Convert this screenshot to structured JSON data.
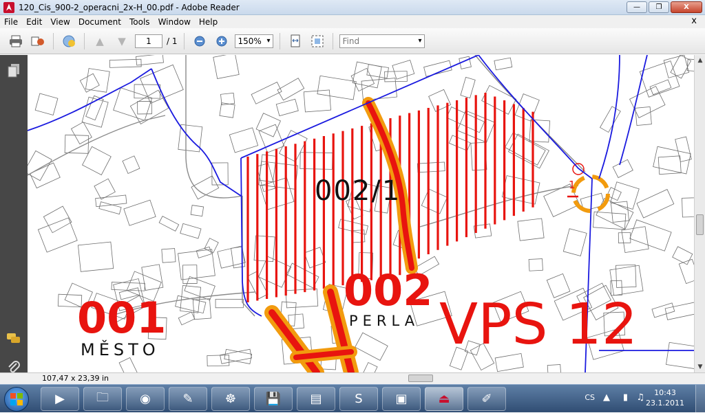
{
  "window": {
    "title": "120_Cis_900-2_operacni_2x-H_00.pdf - Adobe Reader",
    "doc_close_glyph": "x",
    "buttons": {
      "minimize": "—",
      "maximize": "❐",
      "close": "X"
    }
  },
  "menu": [
    "File",
    "Edit",
    "View",
    "Document",
    "Tools",
    "Window",
    "Help"
  ],
  "toolbar": {
    "page_current": "1",
    "page_total": "/ 1",
    "zoom": "150%",
    "find_placeholder": "Find",
    "icons": [
      "print-icon",
      "share-icon",
      "collaborate-icon",
      "previous-page-icon",
      "next-page-icon",
      "zoom-out-icon",
      "zoom-in-icon",
      "fit-width-icon",
      "full-screen-icon"
    ]
  },
  "left_panel": {
    "icons": [
      "pages-icon",
      "comments-icon",
      "attachments-icon"
    ]
  },
  "map": {
    "labels": {
      "zone_hatched": "002/1",
      "zone_001_number": "001",
      "zone_001_name": "MĚSTO",
      "zone_002_number": "002",
      "zone_002_name": "PERLA",
      "vps": "VPS 12",
      "small_marker": "1"
    },
    "colors": {
      "hatch": "#e8140f",
      "boundary": "#1a1adf",
      "road": "#f29b0e",
      "label": "#e8140f"
    }
  },
  "status": {
    "dimensions": "107,47 x 23,39 in"
  },
  "taskbar": {
    "apps": [
      "media-player",
      "explorer",
      "firefox",
      "paint-brush",
      "blender",
      "save",
      "scanner",
      "skype",
      "photo-viewer",
      "adobe-reader",
      "paint"
    ],
    "active_app": "adobe-reader",
    "lang": "CS",
    "time": "10:43",
    "date": "23.1.2011"
  }
}
